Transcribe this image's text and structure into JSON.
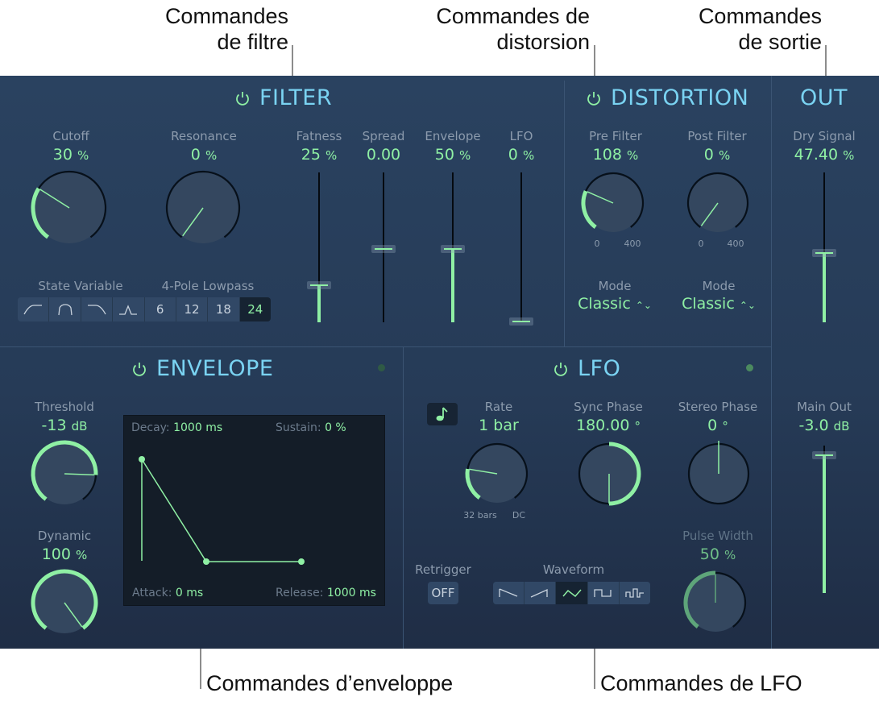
{
  "callouts": {
    "filter": [
      "Commandes",
      "de filtre"
    ],
    "distortion": [
      "Commandes de",
      "distorsion"
    ],
    "output": [
      "Commandes",
      "de sortie"
    ],
    "envelope": "Commandes d’enveloppe",
    "lfo": "Commandes de LFO"
  },
  "colors": {
    "accent_green": "#8ff0a4",
    "title_blue": "#7ad3f2",
    "panel_bg": "#263b57",
    "label_gray": "#8c9bad"
  },
  "filter": {
    "title": "FILTER",
    "power_icon": "power-icon",
    "cutoff": {
      "label": "Cutoff",
      "value": "30",
      "unit": "%",
      "fraction": 0.3
    },
    "resonance": {
      "label": "Resonance",
      "value": "0",
      "unit": "%",
      "fraction": 0.0
    },
    "state_variable_label": "State Variable",
    "four_pole_label": "4-Pole Lowpass",
    "filter_types": [
      "highpass",
      "bandpass",
      "lowpass",
      "peak"
    ],
    "slopes": [
      "6",
      "12",
      "18",
      "24"
    ],
    "selected_slope": "24",
    "faders": [
      {
        "label": "Fatness",
        "value": "25",
        "unit": "%",
        "fraction": 0.25,
        "fill": true
      },
      {
        "label": "Spread",
        "value": "0.00",
        "unit": "",
        "fraction": 0.5,
        "fill": false
      },
      {
        "label": "Envelope",
        "value": "50",
        "unit": "%",
        "fraction": 0.5,
        "fill": true
      },
      {
        "label": "LFO",
        "value": "0",
        "unit": "%",
        "fraction": 0.0,
        "fill": true
      }
    ]
  },
  "distortion": {
    "title": "DISTORTION",
    "pre_filter": {
      "label": "Pre Filter",
      "value": "108",
      "unit": "%",
      "fraction": 0.27,
      "min": "0",
      "max": "400"
    },
    "post_filter": {
      "label": "Post Filter",
      "value": "0",
      "unit": "%",
      "fraction": 0.0,
      "min": "0",
      "max": "400"
    },
    "pre_mode": {
      "label": "Mode",
      "value": "Classic"
    },
    "post_mode": {
      "label": "Mode",
      "value": "Classic"
    }
  },
  "out": {
    "title": "OUT",
    "dry_signal": {
      "label": "Dry Signal",
      "value": "47.40",
      "unit": "%",
      "fraction": 0.474
    },
    "main_out": {
      "label": "Main Out",
      "value": "-3.0",
      "unit": "dB",
      "fraction": 0.96
    }
  },
  "envelope": {
    "title": "ENVELOPE",
    "threshold": {
      "label": "Threshold",
      "value": "-13",
      "unit": "dB",
      "fraction": 0.82
    },
    "dynamic": {
      "label": "Dynamic",
      "value": "100",
      "unit": "%",
      "fraction": 1.0
    },
    "decay": {
      "label": "Decay:",
      "value": "1000 ms"
    },
    "sustain": {
      "label": "Sustain:",
      "value": "0 %"
    },
    "attack": {
      "label": "Attack:",
      "value": "0 ms"
    },
    "release": {
      "label": "Release:",
      "value": "1000 ms"
    }
  },
  "lfo": {
    "title": "LFO",
    "sync_icon": "music-note-icon",
    "rate": {
      "label": "Rate",
      "value": "1 bar",
      "fraction": 0.22,
      "min": "32 bars",
      "max": "DC"
    },
    "sync_phase": {
      "label": "Sync Phase",
      "value": "180.00",
      "unit": "°",
      "fraction": 0.5
    },
    "stereo_phase": {
      "label": "Stereo Phase",
      "value": "0",
      "unit": "°",
      "fraction": 0.5
    },
    "pulse_width": {
      "label": "Pulse Width",
      "value": "50",
      "unit": "%",
      "fraction": 0.5
    },
    "retrigger": {
      "label": "Retrigger",
      "value": "OFF"
    },
    "waveform_label": "Waveform",
    "waveforms": [
      "saw-down",
      "saw-up",
      "triangle",
      "square",
      "pulse"
    ],
    "selected_waveform": "triangle"
  }
}
